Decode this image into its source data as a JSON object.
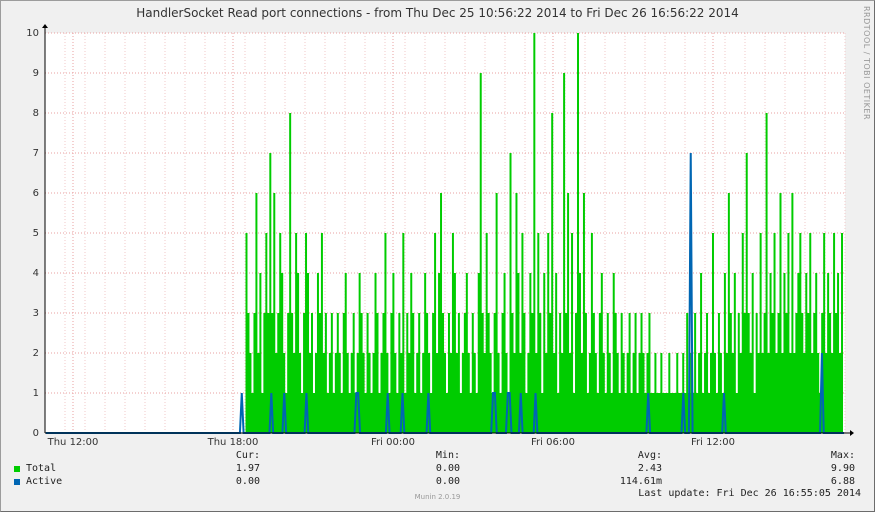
{
  "chart_data": {
    "type": "area",
    "title": "HandlerSocket Read port connections - from Thu Dec 25 10:56:22 2014 to Fri Dec 26 16:56:22 2014",
    "ylim": [
      0,
      10
    ],
    "y_ticks": [
      "0",
      "1",
      "2",
      "3",
      "4",
      "5",
      "6",
      "7",
      "8",
      "9",
      "10"
    ],
    "x_tick_labels": [
      "Thu 12:00",
      "Thu 18:00",
      "Fri 00:00",
      "Fri 06:00",
      "Fri 12:00"
    ],
    "grid": true,
    "series": [
      {
        "name": "Total",
        "color": "#00cc00",
        "values": [
          0,
          0,
          0,
          0,
          0,
          0,
          0,
          0,
          0,
          0,
          0,
          0,
          0,
          0,
          0,
          0,
          0,
          0,
          0,
          0,
          0,
          0,
          0,
          0,
          0,
          0,
          0,
          0,
          0,
          0,
          0,
          0,
          0,
          0,
          0,
          0,
          0,
          0,
          0,
          0,
          0,
          0,
          0,
          0,
          0,
          0,
          0,
          0,
          0,
          0,
          0,
          0,
          0,
          0,
          0,
          0,
          0,
          0,
          0,
          0,
          0,
          0,
          0,
          0,
          0,
          0,
          0,
          0,
          0,
          0,
          0,
          0,
          0,
          0,
          0,
          0,
          0,
          0,
          0,
          0,
          0,
          0,
          0,
          0,
          0,
          0,
          0,
          0,
          0,
          0,
          0,
          0,
          0,
          0,
          0,
          0,
          0,
          0,
          0,
          0,
          0,
          5,
          3,
          2,
          1,
          3,
          6,
          2,
          4,
          1,
          3,
          5,
          3,
          7,
          3,
          6,
          2,
          3,
          5,
          4,
          2,
          1,
          3,
          8,
          3,
          2,
          5,
          4,
          2,
          1,
          3,
          5,
          4,
          2,
          3,
          1,
          2,
          4,
          3,
          5,
          2,
          3,
          1,
          2,
          3,
          1,
          2,
          3,
          2,
          1,
          3,
          4,
          2,
          1,
          2,
          3,
          1,
          2,
          4,
          3,
          2,
          1,
          3,
          2,
          1,
          2,
          4,
          3,
          1,
          2,
          3,
          5,
          2,
          1,
          3,
          4,
          2,
          1,
          3,
          2,
          5,
          1,
          3,
          2,
          4,
          3,
          1,
          2,
          3,
          1,
          2,
          4,
          3,
          2,
          1,
          3,
          5,
          2,
          4,
          6,
          3,
          2,
          1,
          3,
          2,
          5,
          4,
          2,
          3,
          1,
          2,
          3,
          4,
          2,
          1,
          3,
          2,
          1,
          4,
          9,
          3,
          2,
          5,
          3,
          2,
          1,
          3,
          6,
          2,
          1,
          3,
          4,
          2,
          1,
          7,
          3,
          2,
          6,
          4,
          2,
          5,
          3,
          1,
          2,
          4,
          3,
          10,
          2,
          5,
          3,
          1,
          4,
          2,
          5,
          3,
          8,
          2,
          4,
          1,
          3,
          2,
          9,
          3,
          6,
          2,
          5,
          1,
          3,
          10,
          4,
          2,
          6,
          3,
          1,
          2,
          5,
          3,
          2,
          1,
          3,
          4,
          2,
          1,
          3,
          2,
          1,
          4,
          3,
          2,
          1,
          3,
          2,
          1,
          2,
          3,
          1,
          2,
          3,
          1,
          2,
          3,
          2,
          1,
          2,
          3,
          1,
          1,
          2,
          1,
          1,
          2,
          1,
          1,
          1,
          2,
          1,
          1,
          1,
          2,
          1,
          1,
          2,
          1,
          3,
          1,
          2,
          1,
          3,
          1,
          2,
          4,
          1,
          2,
          3,
          1,
          2,
          5,
          2,
          1,
          3,
          2,
          1,
          4,
          2,
          6,
          3,
          2,
          4,
          1,
          3,
          2,
          5,
          3,
          7,
          3,
          2,
          4,
          1,
          3,
          2,
          5,
          2,
          3,
          8,
          2,
          4,
          3,
          5,
          2,
          3,
          6,
          2,
          4,
          3,
          5,
          2,
          6,
          2,
          3,
          4,
          5,
          3,
          2,
          4,
          3,
          5,
          2,
          3,
          4,
          2,
          1,
          3,
          5,
          2,
          4,
          3,
          2,
          5,
          3,
          4,
          2,
          5,
          0
        ]
      },
      {
        "name": "Active",
        "color": "#0066b3",
        "values": [
          0,
          0,
          0,
          0,
          0,
          0,
          0,
          0,
          0,
          0,
          0,
          0,
          0,
          0,
          0,
          0,
          0,
          0,
          0,
          0,
          0,
          0,
          0,
          0,
          0,
          0,
          0,
          0,
          0,
          0,
          0,
          0,
          0,
          0,
          0,
          0,
          0,
          0,
          0,
          0,
          0,
          0,
          0,
          0,
          0,
          0,
          0,
          0,
          0,
          0,
          0,
          0,
          0,
          0,
          0,
          0,
          0,
          0,
          0,
          0,
          0,
          0,
          0,
          0,
          0,
          0,
          0,
          0,
          0,
          0,
          0,
          0,
          0,
          0,
          0,
          0,
          0,
          0,
          0,
          0,
          0,
          0,
          0,
          0,
          0,
          0,
          0,
          0,
          0,
          0,
          0,
          0,
          0,
          0,
          0,
          0,
          0,
          0,
          0,
          0,
          0,
          0,
          0,
          0,
          0,
          0,
          1,
          0,
          0,
          0,
          0,
          0,
          0,
          0,
          0,
          0,
          0,
          0,
          0,
          0,
          0,
          0,
          1,
          0,
          0,
          0,
          0,
          0,
          0,
          1,
          0,
          0,
          0,
          0,
          0,
          0,
          0,
          0,
          0,
          0,
          0,
          1,
          0,
          0,
          0,
          0,
          0,
          0,
          0,
          0,
          0,
          0,
          0,
          0,
          0,
          0,
          0,
          0,
          0,
          0,
          0,
          0,
          0,
          0,
          0,
          0,
          0,
          0,
          1,
          1,
          0,
          0,
          0,
          0,
          0,
          0,
          0,
          0,
          0,
          0,
          0,
          0,
          0,
          0,
          0,
          1,
          0,
          0,
          0,
          0,
          0,
          0,
          0,
          1,
          0,
          0,
          0,
          0,
          0,
          0,
          0,
          0,
          0,
          0,
          0,
          0,
          0,
          1,
          0,
          0,
          0,
          0,
          0,
          0,
          0,
          0,
          0,
          0,
          0,
          0,
          0,
          0,
          0,
          0,
          0,
          0,
          0,
          0,
          0,
          0,
          0,
          0,
          0,
          0,
          0,
          0,
          0,
          0,
          0,
          0,
          0,
          0,
          1,
          1,
          0,
          0,
          0,
          0,
          0,
          0,
          1,
          1,
          0,
          0,
          0,
          0,
          0,
          1,
          0,
          0,
          0,
          0,
          0,
          0,
          0,
          1,
          0,
          0,
          0,
          0,
          0,
          0,
          0,
          0,
          0,
          0,
          0,
          0,
          0,
          0,
          0,
          0,
          0,
          0,
          0,
          0,
          0,
          0,
          0,
          0,
          0,
          0,
          0,
          0,
          0,
          0,
          0,
          0,
          0,
          0,
          0,
          0,
          0,
          0,
          0,
          0,
          0,
          0,
          0,
          0,
          0,
          0,
          0,
          0,
          0,
          0,
          0,
          0,
          0,
          0,
          0,
          0,
          0,
          0,
          0,
          0,
          1,
          0,
          0,
          0,
          0,
          0,
          0,
          0,
          0,
          0,
          0,
          0,
          0,
          0,
          0,
          0,
          0,
          0,
          0,
          1,
          0,
          0,
          0,
          7,
          0,
          0,
          0,
          0,
          0,
          0,
          0,
          0,
          0,
          0,
          0,
          0,
          0,
          0,
          0,
          0,
          0,
          1,
          0,
          0,
          0,
          0,
          0,
          0,
          0,
          0,
          0,
          0,
          0,
          0,
          0,
          0,
          0,
          0,
          0,
          0,
          0,
          0,
          0,
          0,
          0,
          0,
          0,
          0,
          0,
          0,
          0,
          0,
          0,
          0,
          0,
          0,
          0,
          0,
          0,
          0,
          0,
          0,
          0,
          0,
          0,
          0,
          0,
          0,
          0,
          0,
          0,
          0,
          0,
          0,
          2,
          0,
          0,
          0,
          0,
          0,
          0,
          0,
          0,
          0,
          0,
          0,
          0
        ]
      }
    ]
  },
  "vendor": "RRDTOOL / TOBI OETIKER",
  "legend": {
    "headers": {
      "cur": "Cur:",
      "min": "Min:",
      "avg": "Avg:",
      "max": "Max:"
    },
    "rows": [
      {
        "name": "Total",
        "color": "#00cc00",
        "cur": "1.97",
        "min": "0.00",
        "avg": "2.43",
        "max": "9.90"
      },
      {
        "name": "Active",
        "color": "#0066b3",
        "cur": "0.00",
        "min": "0.00",
        "avg": "114.61m",
        "max": "6.88"
      }
    ],
    "last_update": "Last update: Fri Dec 26 16:55:05 2014"
  },
  "footer": "Munin 2.0.19"
}
